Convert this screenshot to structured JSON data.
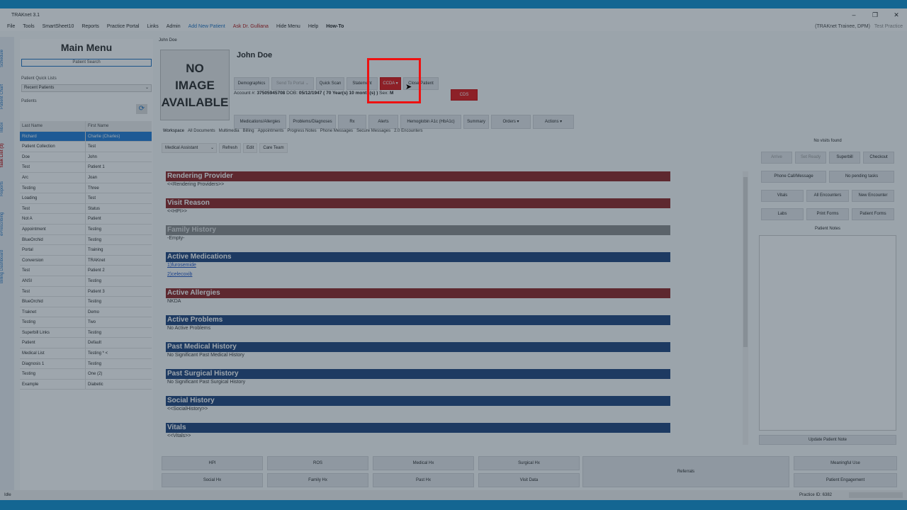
{
  "window": {
    "title": "TRAKnet 3.1"
  },
  "menu": {
    "items": [
      "File",
      "Tools",
      "SmartSheet10",
      "Reports",
      "Practice Portal",
      "Links",
      "Admin"
    ],
    "add_patient": "Add New Patient",
    "ask": "Ask Dr. Gulliana",
    "hide": "Hide Menu",
    "help": "Help",
    "howto": "How-To",
    "user": "(TRAKnet Trainee, DPM)",
    "practice": "Test Practice"
  },
  "side_tabs": [
    "Schedule",
    "Patient Chart",
    "Inbox",
    "Task List (3)",
    "Reports",
    "ePrescribing",
    "Billing Dashboard"
  ],
  "left": {
    "title": "Main Menu",
    "search": "Patient Search",
    "quick_lists": "Patient Quick Lists",
    "recent": "Recent Patients",
    "patients_label": "Patients",
    "col_last": "Last Name",
    "col_first": "First Name",
    "rows": [
      [
        "Richard",
        "Charlie (Charles)"
      ],
      [
        "Patient Collection",
        "Test"
      ],
      [
        "Doe",
        "John"
      ],
      [
        "Test",
        "Patient 1"
      ],
      [
        "Arc",
        "Joan"
      ],
      [
        "Testing",
        "Three"
      ],
      [
        "Loading",
        "Test"
      ],
      [
        "Test",
        "Status"
      ],
      [
        "Not A",
        "Patient"
      ],
      [
        "Appointment",
        "Testing"
      ],
      [
        "BlueOrchid",
        "Testing"
      ],
      [
        "Portal",
        "Training"
      ],
      [
        "Conversion",
        "TRAKnet"
      ],
      [
        "Test",
        "Patient 2"
      ],
      [
        "ANSI",
        "Testing"
      ],
      [
        "Test",
        "Patient 3"
      ],
      [
        "BlueOrchid",
        "Testing"
      ],
      [
        "Traknet",
        "Demo"
      ],
      [
        "Testing",
        "Two"
      ],
      [
        "Superbill Links",
        "Testing"
      ],
      [
        "Patient",
        "Default"
      ],
      [
        "Medical List",
        "Testing * <"
      ],
      [
        "Diagnosis 1",
        "Testing"
      ],
      [
        "Testing",
        "One (2)"
      ],
      [
        "Example",
        "Diabetic"
      ]
    ]
  },
  "patient": {
    "crumb": "John Doe",
    "no_image_1": "NO",
    "no_image_2": "IMAGE",
    "no_image_3": "AVAILABLE",
    "name": "John Doe",
    "account_label": "Account #:",
    "account": "37505945708",
    "dob_label": "DOB:",
    "dob": "05/12/1947 ( 70 ",
    "age": "Year(s) 10 month(s) )",
    "sex_label": "Sex:",
    "sex": "M",
    "cds": "CDS"
  },
  "buttons_row1": {
    "demographics": "Demographics",
    "send_portal": "Send To Portal",
    "quick_scan": "Quick Scan",
    "statement": "Statement",
    "ccda": "CCDA",
    "close": "Close Patient"
  },
  "buttons_row2": [
    "Medications/Allergies",
    "Problems/Diagnoses",
    "Rx",
    "Alerts",
    "Hemoglobin A1c (HbA1c)",
    "Summary",
    "Orders",
    "Actions"
  ],
  "tabs": [
    "Workspace",
    "All Documents",
    "Multimedia",
    "Billing",
    "Appointments",
    "Progress Notes",
    "Phone Messages",
    "Secure Messages",
    "2.0 Encounters"
  ],
  "workspace_bar": {
    "role": "Medical Assistant",
    "refresh": "Refresh",
    "edit": "Edit",
    "care_team": "Care Team"
  },
  "sections": [
    {
      "title": "Rendering Provider",
      "color": "brown",
      "lines": [
        "<<Rendering Providers>>"
      ]
    },
    {
      "title": "Visit Reason",
      "color": "brown",
      "lines": [
        "<<HPI>>"
      ]
    },
    {
      "title": "Family History",
      "color": "gray",
      "lines": [
        "-Empty-"
      ]
    },
    {
      "title": "Active Medications",
      "color": "navy",
      "lines": [
        "1)furosemide",
        "2)celecoxib"
      ],
      "link": true
    },
    {
      "title": "Active Allergies",
      "color": "brown",
      "lines": [
        "NKDA"
      ]
    },
    {
      "title": "Active Problems",
      "color": "navy",
      "lines": [
        "No Active Problems"
      ]
    },
    {
      "title": "Past Medical History",
      "color": "navy",
      "lines": [
        "No Significant Past Medical History"
      ]
    },
    {
      "title": "Past Surgical History",
      "color": "navy",
      "lines": [
        "No Significant Past Surgical History"
      ]
    },
    {
      "title": "Social History",
      "color": "navy",
      "lines": [
        "<<SocialHistory>>"
      ]
    },
    {
      "title": "Vitals",
      "color": "navy",
      "lines": [
        "<<Vitals>>"
      ]
    }
  ],
  "right": {
    "no_visits": "No visits found",
    "row1": [
      "Arrive",
      "Set Ready",
      "Superbill",
      "Checkout"
    ],
    "row2": [
      "Phone Call/Message",
      "No pending tasks"
    ],
    "row3": [
      "Vitals",
      "All Encounters",
      "New Encounter"
    ],
    "row4": [
      "Labs",
      "Print Forms",
      "Patient Forms"
    ],
    "notes_label": "Patient Notes",
    "update_note": "Update Patient Note"
  },
  "bottom": {
    "row1": [
      "HPI",
      "ROS",
      "Medical Hx",
      "Surgical Hx"
    ],
    "row2": [
      "Social Hx",
      "Family Hx",
      "Past Hx",
      "Visit Data"
    ],
    "referrals": "Referrals",
    "meaningful": "Meaningful Use",
    "engagement": "Patient Engagement"
  },
  "status": {
    "left": "Idle",
    "practice": "Practice ID: 6382"
  }
}
